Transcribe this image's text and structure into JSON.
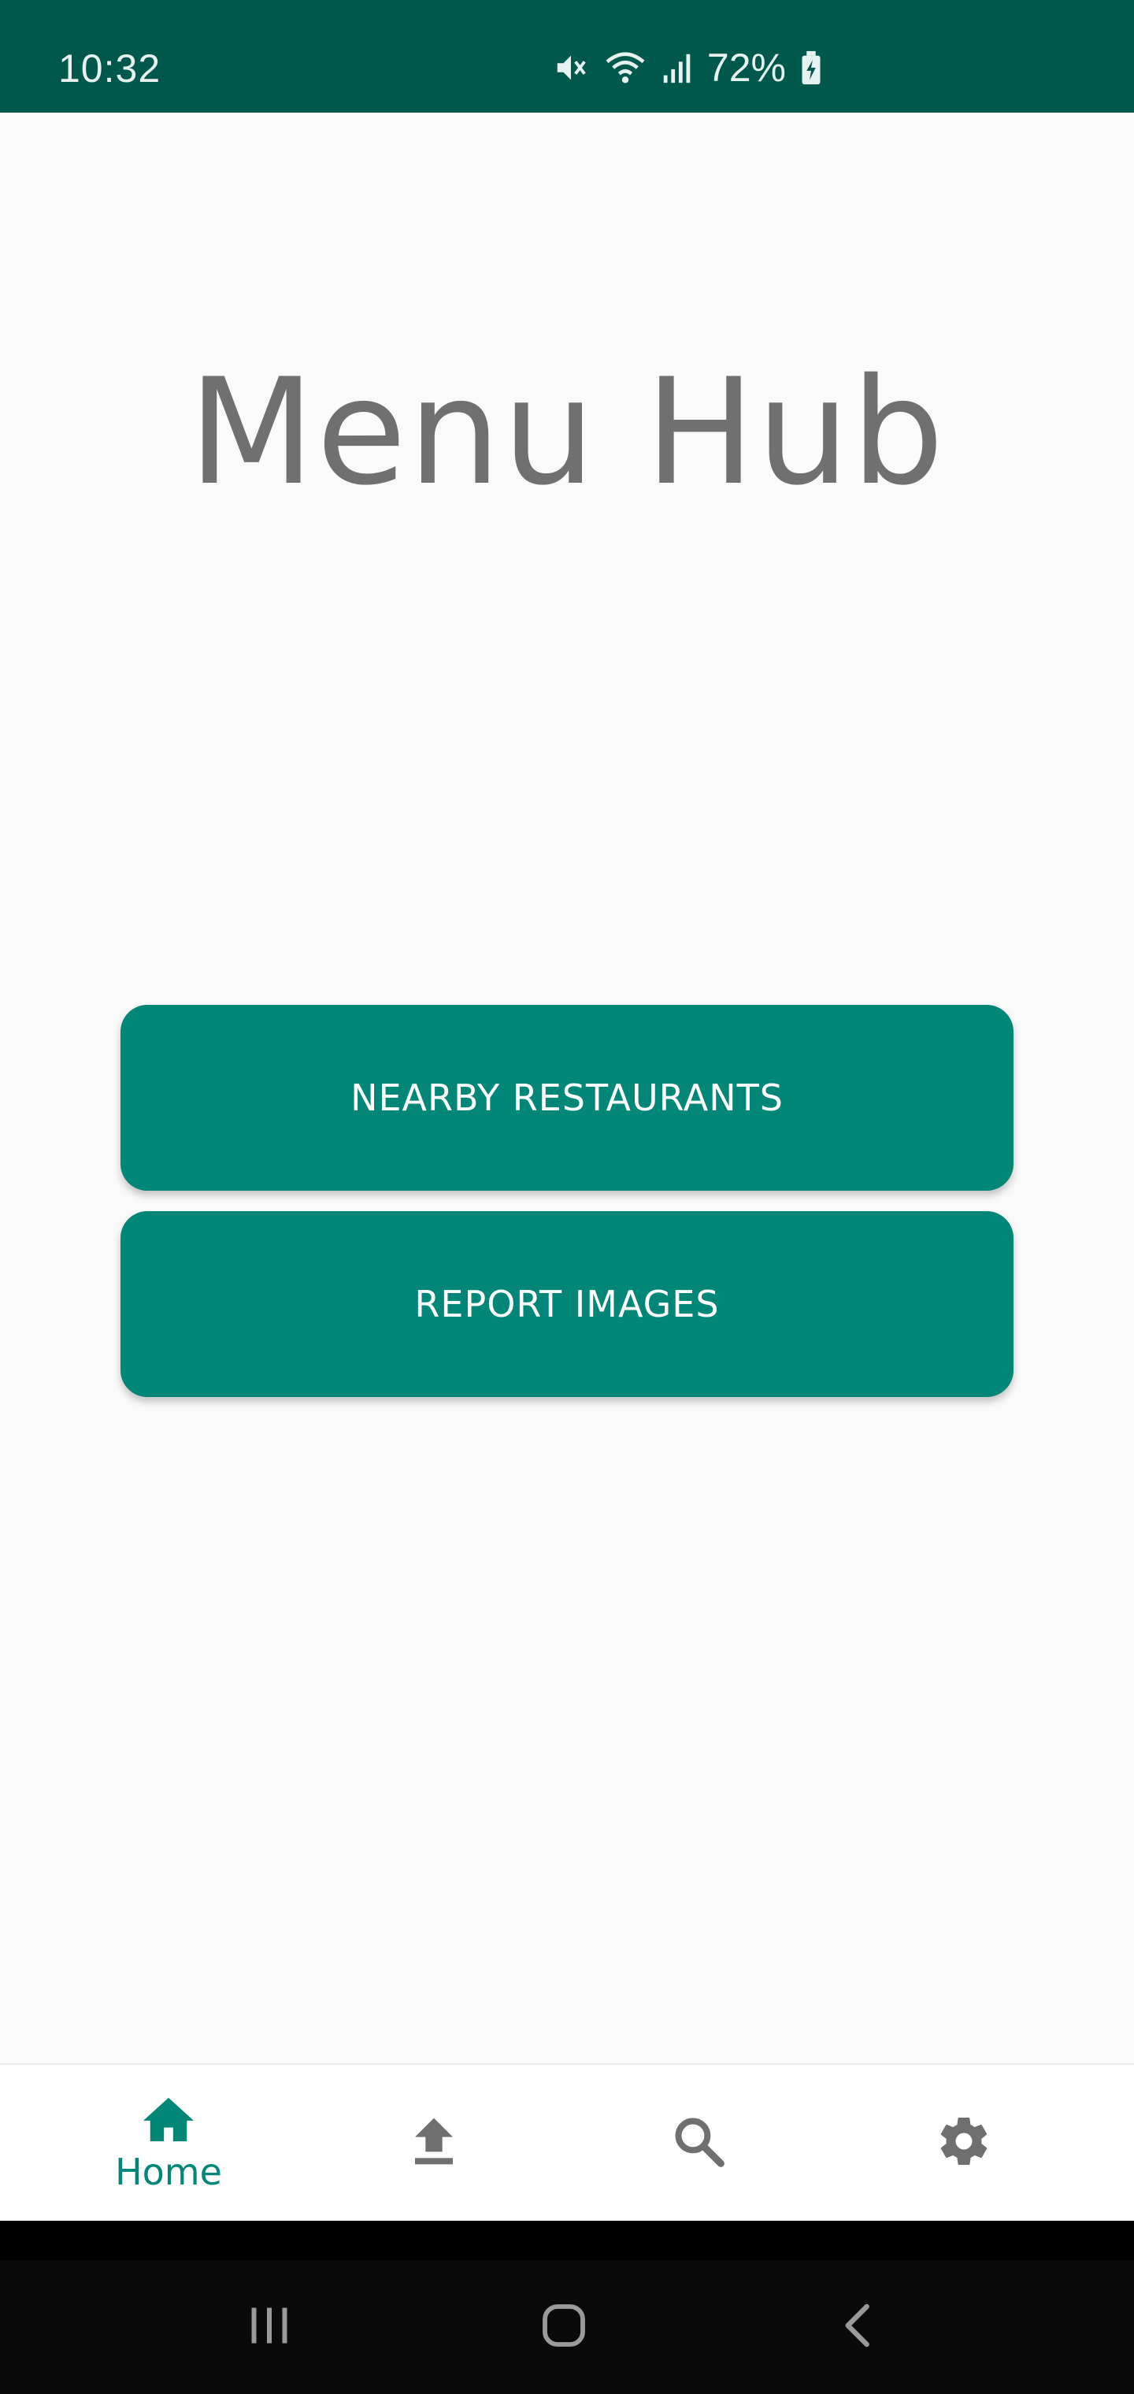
{
  "status_bar": {
    "time": "10:32",
    "battery_percent": "72%",
    "icons": [
      "mute-icon",
      "wifi-icon",
      "signal-icon",
      "battery-charging-icon"
    ]
  },
  "app": {
    "title": "Menu Hub"
  },
  "actions": {
    "nearby_label": "NEARBY RESTAURANTS",
    "report_label": "REPORT IMAGES"
  },
  "bottom_nav": {
    "active": "home",
    "items": [
      {
        "id": "home",
        "label": "Home",
        "icon": "home-icon"
      },
      {
        "id": "upload",
        "label": "",
        "icon": "upload-icon"
      },
      {
        "id": "search",
        "label": "",
        "icon": "search-icon"
      },
      {
        "id": "settings",
        "label": "",
        "icon": "gear-icon"
      }
    ]
  },
  "colors": {
    "status_bar": "#00574b",
    "accent": "#028677",
    "inactive_icon": "#6f6f6f",
    "background": "#fafafa"
  }
}
